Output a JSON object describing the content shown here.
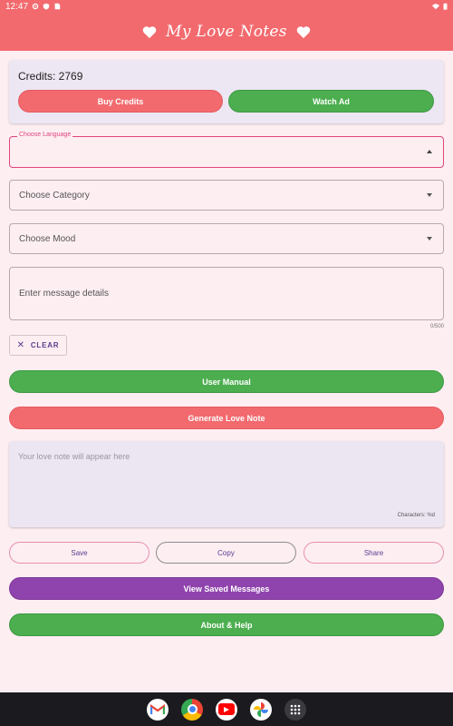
{
  "status": {
    "time": "12:47"
  },
  "header": {
    "title": "My Love Notes"
  },
  "credits": {
    "label": "Credits: 2769",
    "buy_label": "Buy Credits",
    "watch_label": "Watch Ad"
  },
  "form": {
    "language_label": "Choose Language",
    "category_placeholder": "Choose Category",
    "mood_placeholder": "Choose Mood",
    "details_placeholder": "Enter message details",
    "counter": "0/500",
    "clear_label": "CLEAR"
  },
  "actions": {
    "manual_label": "User Manual",
    "generate_label": "Generate Love Note"
  },
  "output": {
    "placeholder": "Your love note will appear here",
    "char_count": "Characters: %d"
  },
  "buttons": {
    "save_label": "Save",
    "copy_label": "Copy",
    "share_label": "Share",
    "saved_label": "View Saved Messages",
    "about_label": "About & Help"
  },
  "nav": {
    "apps": [
      "gmail-icon",
      "chrome-icon",
      "youtube-icon",
      "photos-icon",
      "app-drawer-icon"
    ]
  },
  "colors": {
    "primary": "#f26a6e",
    "green": "#4cae4f",
    "purple": "#8f44ad",
    "background": "#fdeef2",
    "card": "#ede6f3",
    "focus": "#e0457e"
  }
}
